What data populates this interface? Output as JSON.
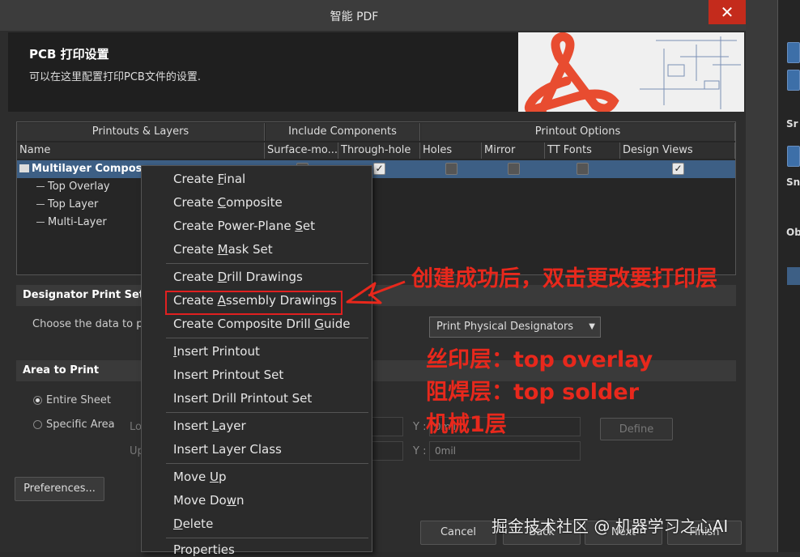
{
  "window": {
    "title": "智能 PDF",
    "close_glyph": "✕"
  },
  "header": {
    "title": "PCB 打印设置",
    "subtitle": "可以在这里配置打印PCB文件的设置."
  },
  "table": {
    "groups": [
      "Printouts & Layers",
      "Include Components",
      "Printout Options"
    ],
    "columns": [
      "Name",
      "Surface-mo...",
      "Through-hole",
      "Holes",
      "Mirror",
      "TT Fonts",
      "Design Views"
    ],
    "rows": [
      {
        "name": "Multilayer Composite Print"
      },
      {
        "name": "Top Overlay"
      },
      {
        "name": "Top Layer"
      },
      {
        "name": "Multi-Layer"
      }
    ]
  },
  "designator": {
    "section": "Designator Print Settings",
    "label": "Choose the data to print",
    "select_value": "Print Physical Designators"
  },
  "area": {
    "section": "Area to Print",
    "entire": "Entire Sheet",
    "specific": "Specific Area",
    "lower_label": "Lo",
    "upper_label": "Up",
    "y_label": "Y :",
    "lower_y": "0mil",
    "upper_y": "0mil",
    "define": "Define"
  },
  "buttons": {
    "preferences": "Preferences...",
    "cancel": "Cancel",
    "back": "Back",
    "next": "Next",
    "finish": "Finish"
  },
  "menu": {
    "items": [
      {
        "pre": "Create ",
        "u": "F",
        "post": "inal"
      },
      {
        "pre": "Create ",
        "u": "C",
        "post": "omposite"
      },
      {
        "pre": "Create Power-Plane ",
        "u": "S",
        "post": "et"
      },
      {
        "pre": "Create ",
        "u": "M",
        "post": "ask Set"
      },
      {
        "pre": "Create ",
        "u": "D",
        "post": "rill Drawings"
      },
      {
        "pre": "Create ",
        "u": "A",
        "post": "ssembly Drawings"
      },
      {
        "pre": "Create Composite Drill ",
        "u": "G",
        "post": "uide"
      },
      {
        "pre": "",
        "u": "I",
        "post": "nsert Printout"
      },
      {
        "pre": "Insert Printout Set",
        "u": "",
        "post": ""
      },
      {
        "pre": "Insert Drill Printout Set",
        "u": "",
        "post": ""
      },
      {
        "pre": "Insert ",
        "u": "L",
        "post": "ayer"
      },
      {
        "pre": "Insert Layer Class",
        "u": "",
        "post": ""
      },
      {
        "pre": "Move ",
        "u": "U",
        "post": "p"
      },
      {
        "pre": "Move Do",
        "u": "w",
        "post": "n"
      },
      {
        "pre": "",
        "u": "D",
        "post": "elete"
      },
      {
        "pre": "Properties",
        "u": "",
        "post": ""
      }
    ]
  },
  "annotations": {
    "line1": "创建成功后，双击更改要打印层",
    "line2": "丝印层：top overlay",
    "line3": "阻焊层：top solder",
    "line4": "机械1层"
  },
  "side_panel": {
    "a": "Sr",
    "b": "Sn",
    "c": "Ob"
  },
  "watermark": "掘金技术社区 @ 机器学习之心AI",
  "colors": {
    "accent": "#3d5f85",
    "annotation": "#e8281c",
    "close": "#c42b1c"
  }
}
